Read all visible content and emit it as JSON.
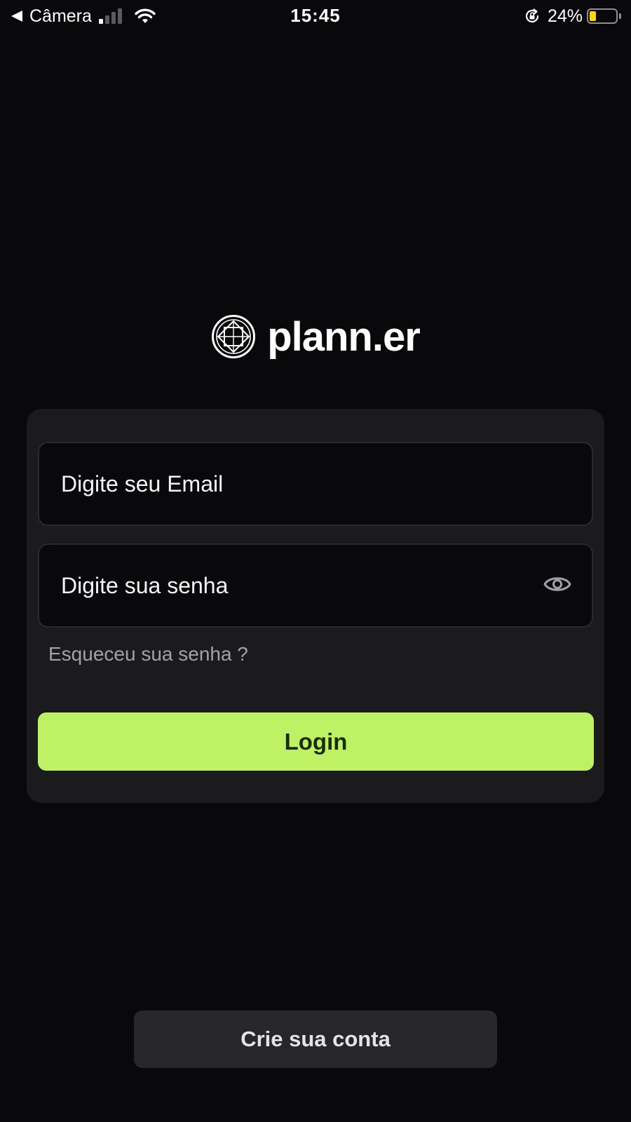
{
  "status_bar": {
    "carrier": "Câmera",
    "time": "15:45",
    "battery_percent": "24%",
    "battery_level": 0.24,
    "signal_bars_active": 1,
    "signal_bars_total": 4,
    "battery_fill_color": "#ffd60a"
  },
  "brand": {
    "name": "plann.er",
    "logo_icon": "planner-logo-icon"
  },
  "login_form": {
    "email_placeholder": "Digite seu Email",
    "password_placeholder": "Digite sua senha",
    "password_toggle_icon": "eye-icon",
    "forgot_password": "Esqueceu sua senha ?",
    "login_label": "Login"
  },
  "create_account": {
    "label": "Crie sua conta"
  },
  "colors": {
    "background": "#09090b",
    "card": "#1b1b1e",
    "accent": "#bef264",
    "accent_text": "#1a2e05",
    "secondary_button": "#27272a",
    "muted_text": "#a1a1aa"
  }
}
